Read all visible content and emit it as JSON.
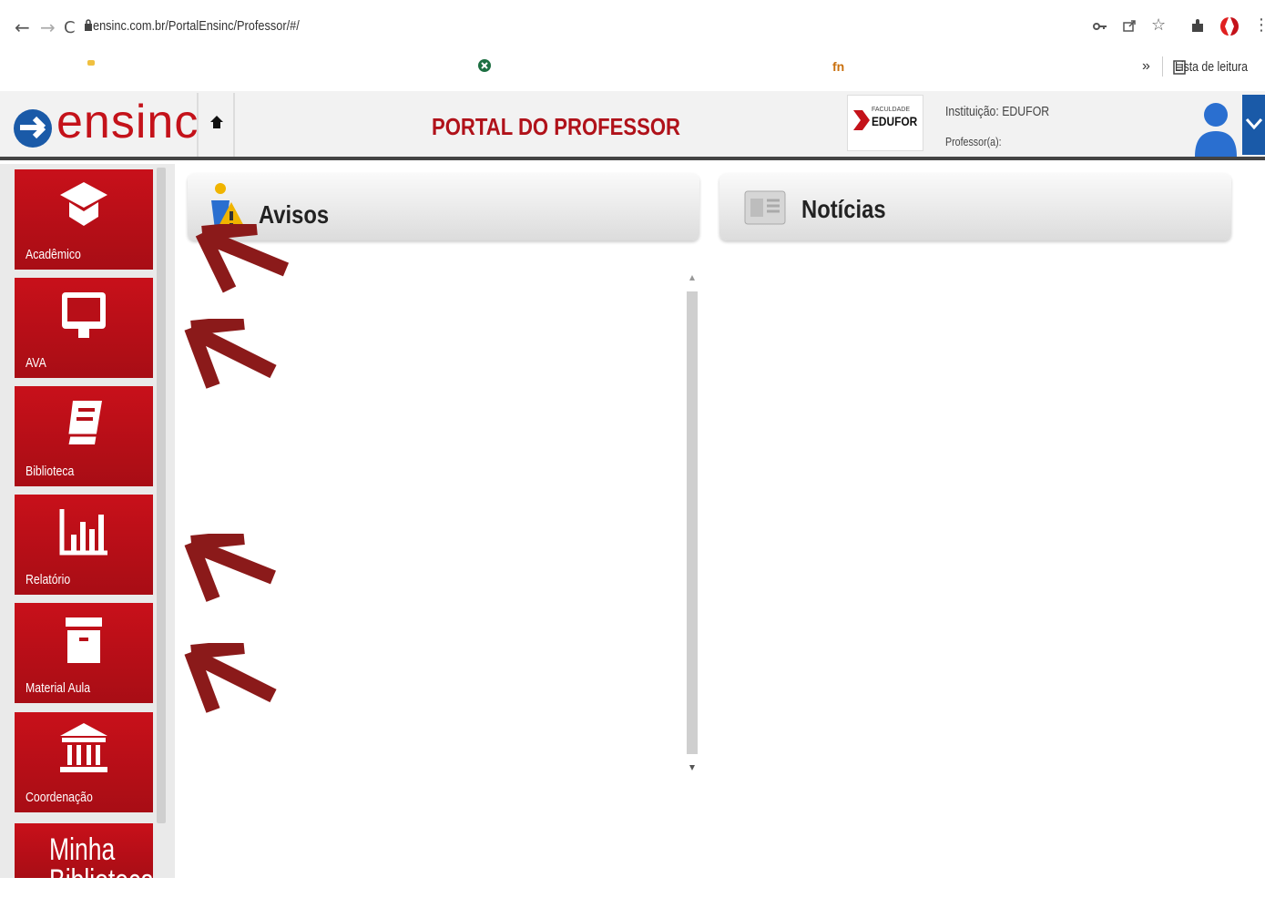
{
  "browser": {
    "url": "ensinc.com.br/PortalEnsinc/Professor/#/",
    "back": "←",
    "forward": "→",
    "reload": "C",
    "more_bookmarks": "»",
    "reading_list": "Lista de leitura"
  },
  "header": {
    "logo_text": "ensinc",
    "title": "PORTAL DO PROFESSOR",
    "institution": "Instituição: EDUFOR",
    "professor": "Professor(a):",
    "institution_logo": {
      "text": "EDUFOR",
      "prefix": "FACULDADE"
    }
  },
  "sidebar": {
    "items": [
      {
        "label": "Acadêmico",
        "icon": "graduation-cap-icon"
      },
      {
        "label": "AVA",
        "icon": "monitor-icon"
      },
      {
        "label": "Biblioteca",
        "icon": "book-icon"
      },
      {
        "label": "Relatório",
        "icon": "bar-chart-icon"
      },
      {
        "label": "Material Aula",
        "icon": "archive-box-icon"
      },
      {
        "label": "Coordenação",
        "icon": "institution-icon"
      },
      {
        "label": "Minha Biblioteca"
      }
    ]
  },
  "panels": {
    "avisos": {
      "title": "Avisos",
      "icon": "warning-person-icon"
    },
    "noticias": {
      "title": "Notícias",
      "icon": "newspaper-icon"
    }
  },
  "colors": {
    "brand_red": "#c4121a",
    "sidebar_red": "#c8101a",
    "annotation_arrow": "#8b1a1a",
    "user_blue": "#1a5aa8"
  }
}
